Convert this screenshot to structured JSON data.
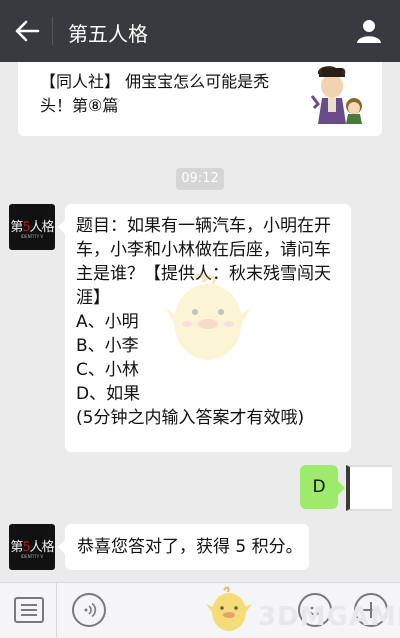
{
  "header": {
    "title": "第五人格"
  },
  "article_card": {
    "text": "【同人社】 佣宝宝怎么可能是秃头！第⑧篇"
  },
  "timestamp": "09:12",
  "messages": [
    {
      "side": "left",
      "sender_logo": "第5人格",
      "sender_logo_sub": "IDENTITY V",
      "lines": [
        "题目：如果有一辆汽车，小明在开",
        "车，小李和小林做在后座，请问车",
        "主是谁？【提供人：秋末残雪闯天",
        "涯】",
        "A、小明",
        "B、小李",
        "C、小林",
        "D、如果",
        "(5分钟之内输入答案才有效哦)"
      ]
    },
    {
      "side": "right",
      "text": "D"
    },
    {
      "side": "left",
      "sender_logo": "第5人格",
      "sender_logo_sub": "IDENTITY V",
      "text": "恭喜您答对了，获得 5 积分。"
    }
  ],
  "watermark": "3DMGAME",
  "colors": {
    "topbar": "#393a3f",
    "background": "#ebebeb",
    "sent_bubble": "#9eea6a"
  }
}
